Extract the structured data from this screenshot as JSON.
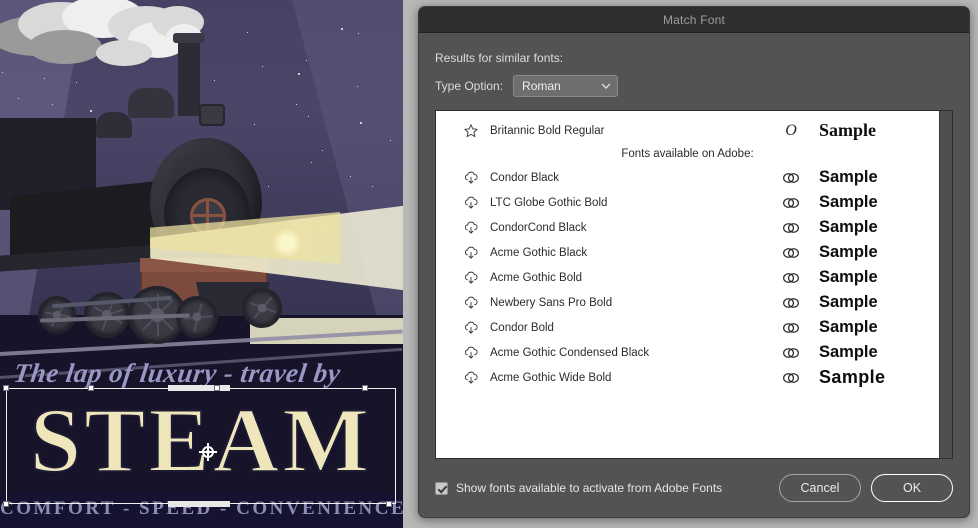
{
  "dialog": {
    "title": "Match Font",
    "results_label": "Results for similar fonts:",
    "type_option_label": "Type Option:",
    "type_option_value": "Roman",
    "type_option_choices": [
      "Roman"
    ],
    "adobe_divider_label": "Fonts available on Adobe:",
    "sample_text": "Sample",
    "checkbox_label": "Show fonts available to activate from Adobe Fonts",
    "checkbox_checked": true,
    "cancel_label": "Cancel",
    "ok_label": "OK",
    "colors": {
      "dialog_bg": "#535353",
      "titlebar_bg": "#2e2e2e",
      "list_bg": "#ffffff",
      "title_text": "#9d9d9d",
      "body_text": "#dcdcdc"
    }
  },
  "font_list": {
    "local": [
      {
        "name": "Britannic Bold Regular",
        "icon": "star-outline-icon",
        "type_icon": "opentype-icon",
        "sample": "Sample",
        "sample_style": "serif"
      }
    ],
    "adobe": [
      {
        "name": "Condor Black",
        "icon": "cloud-download-icon",
        "type_icon": "creative-cloud-icon",
        "sample": "Sample",
        "sample_style": "cond"
      },
      {
        "name": "LTC Globe Gothic Bold",
        "icon": "cloud-download-icon",
        "type_icon": "creative-cloud-icon",
        "sample": "Sample",
        "sample_style": "cond"
      },
      {
        "name": "CondorCond Black",
        "icon": "cloud-download-icon",
        "type_icon": "creative-cloud-icon",
        "sample": "Sample",
        "sample_style": "cond"
      },
      {
        "name": "Acme Gothic Black",
        "icon": "cloud-download-icon",
        "type_icon": "creative-cloud-icon",
        "sample": "Sample",
        "sample_style": "cond"
      },
      {
        "name": "Acme Gothic Bold",
        "icon": "cloud-download-icon",
        "type_icon": "creative-cloud-icon",
        "sample": "Sample",
        "sample_style": "cond"
      },
      {
        "name": "Newbery Sans Pro Bold",
        "icon": "cloud-download-icon",
        "type_icon": "creative-cloud-icon",
        "sample": "Sample",
        "sample_style": "cond"
      },
      {
        "name": "Condor Bold",
        "icon": "cloud-download-icon",
        "type_icon": "creative-cloud-icon",
        "sample": "Sample",
        "sample_style": "cond"
      },
      {
        "name": "Acme Gothic Condensed Black",
        "icon": "cloud-download-icon",
        "type_icon": "creative-cloud-icon",
        "sample": "Sample",
        "sample_style": "cond"
      },
      {
        "name": "Acme Gothic Wide Bold",
        "icon": "cloud-download-icon",
        "type_icon": "creative-cloud-icon",
        "sample": "Sample",
        "sample_style": "sans"
      }
    ]
  },
  "canvas": {
    "artwork_title": "steam-locomotive-night-poster",
    "script_line": "The lap of luxury - travel by",
    "headline": "STEAM",
    "tagline": "COMFORT  -  SPEED  -  CONVENIENCE",
    "colors": {
      "sky": "#474263",
      "headline_fill": "#efe7bb",
      "script_fill": "#9a97c4",
      "band_bg": "#151330",
      "tender": "#7d4b3d"
    }
  }
}
